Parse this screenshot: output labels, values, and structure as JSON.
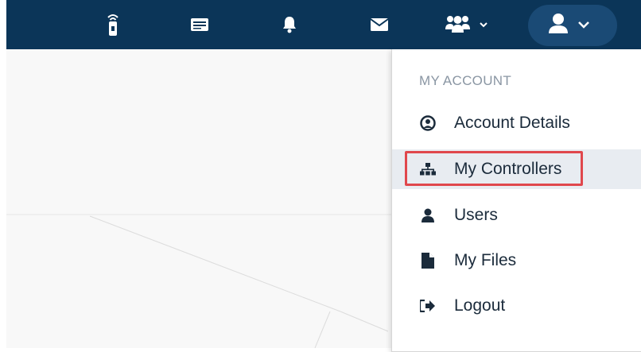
{
  "topbar": {
    "icons": [
      "remote-icon",
      "list-icon",
      "bell-icon",
      "envelope-icon",
      "users-icon",
      "user-icon"
    ],
    "colors": {
      "background": "#0b3558",
      "pill": "#1a4a75"
    }
  },
  "dropdown": {
    "header": "MY ACCOUNT",
    "items": [
      {
        "label": "Account Details",
        "icon": "user-circle-icon"
      },
      {
        "label": "My Controllers",
        "icon": "sitemap-icon",
        "active": true
      },
      {
        "label": "Users",
        "icon": "user-icon"
      },
      {
        "label": "My Files",
        "icon": "file-icon"
      },
      {
        "label": "Logout",
        "icon": "sign-out-icon"
      }
    ],
    "highlight_color": "#e0474c"
  }
}
